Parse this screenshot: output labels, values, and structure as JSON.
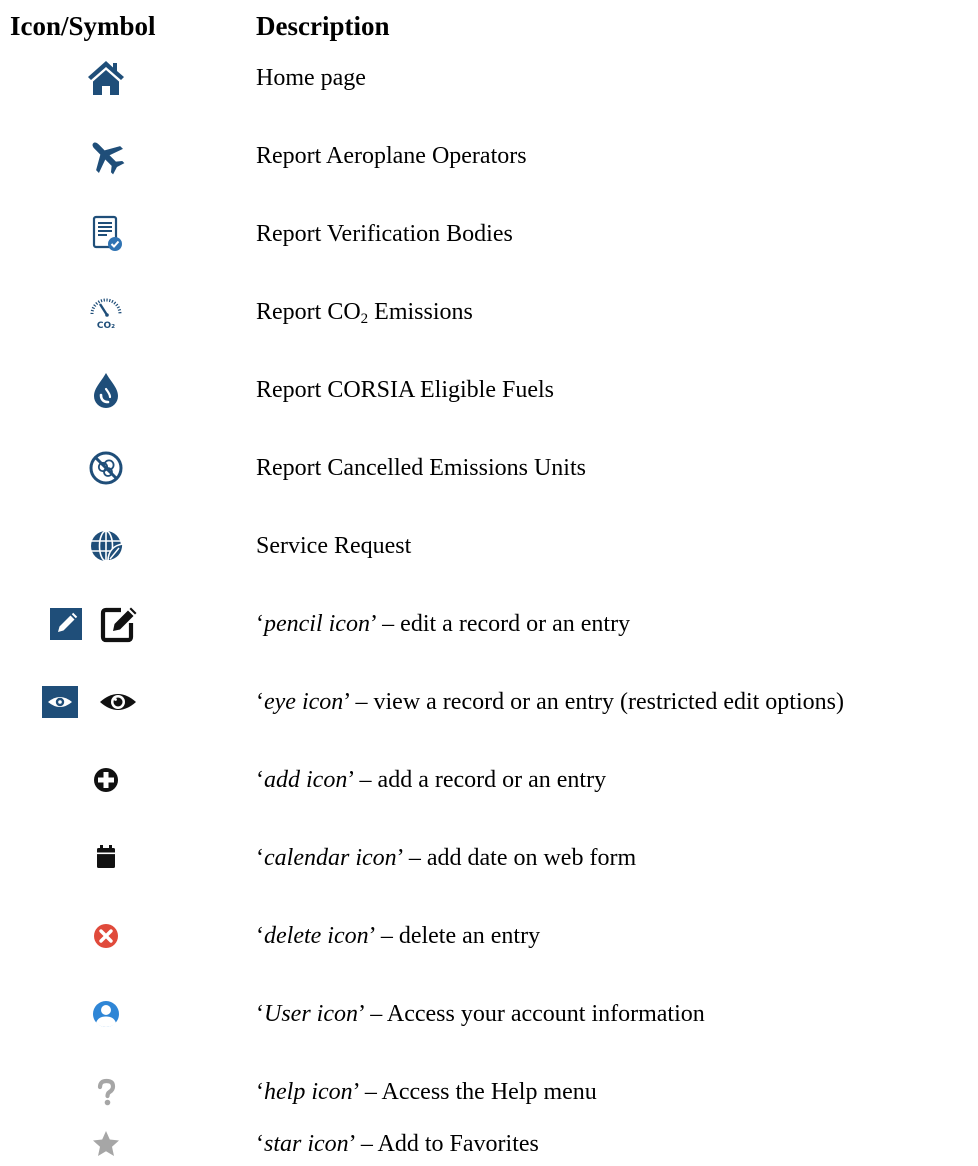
{
  "header": {
    "icon_col": "Icon/Symbol",
    "desc_col": "Description"
  },
  "rows": [
    {
      "icon": "home-icon",
      "description": "Home page"
    },
    {
      "icon": "airplane-icon",
      "description": "Report Aeroplane Operators"
    },
    {
      "icon": "verified-document-icon",
      "description": "Report Verification Bodies"
    },
    {
      "icon": "co2-gauge-icon",
      "description_prefix": "Report CO",
      "description_sub": "2",
      "description_suffix": " Emissions"
    },
    {
      "icon": "fuel-drop-icon",
      "description": "Report CORSIA Eligible Fuels"
    },
    {
      "icon": "cancelled-emissions-icon",
      "description": "Report Cancelled Emissions Units"
    },
    {
      "icon": "globe-leaf-icon",
      "description": "Service Request"
    },
    {
      "icons": [
        "pencil-square-icon",
        "edit-icon"
      ],
      "open_quote": "‘",
      "term": "pencil icon",
      "rest": "’ – edit a record or an entry"
    },
    {
      "icons": [
        "eye-square-icon",
        "eye-icon"
      ],
      "open_quote": "‘",
      "term": "eye icon",
      "rest": "’ – view a record or an entry (restricted edit options)"
    },
    {
      "icon": "add-icon",
      "open_quote": "‘",
      "term": "add icon",
      "rest": "’ – add a record or an entry"
    },
    {
      "icon": "calendar-icon",
      "open_quote": "‘",
      "term": "calendar icon",
      "rest": "’ – add date on web form"
    },
    {
      "icon": "delete-icon",
      "open_quote": "‘",
      "term": "delete icon",
      "rest": "’ – delete an entry"
    },
    {
      "icon": "user-icon",
      "open_quote": "‘",
      "term": "User icon",
      "rest": "’ – Access your account information"
    },
    {
      "icon": "help-icon",
      "open_quote": "‘",
      "term": "help icon",
      "rest": "’ – Access the Help menu"
    },
    {
      "icon": "star-icon",
      "open_quote": "‘",
      "term": "star icon",
      "rest": "’ – Add to Favorites"
    }
  ],
  "colors": {
    "navy": "#1f4e79",
    "black": "#111111",
    "delete_red": "#e04a3b",
    "user_blue": "#2f86d6",
    "gray": "#a6a6a6"
  }
}
